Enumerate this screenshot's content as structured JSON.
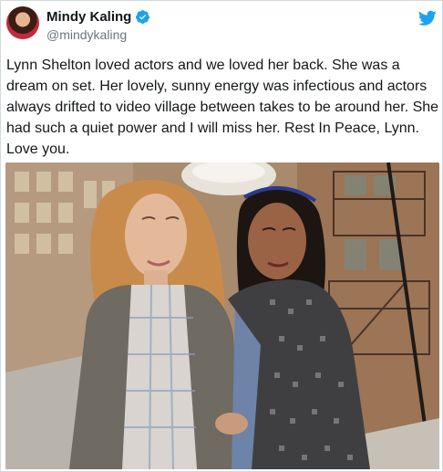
{
  "author": {
    "display_name": "Mindy Kaling",
    "handle": "@mindykaling",
    "verified": true,
    "avatar_icon": "profile-avatar"
  },
  "brand": {
    "icon": "twitter-bird-icon",
    "color": "#1da1f2"
  },
  "tweet": {
    "lines": [
      "Lynn Shelton loved actors and we loved her back. She was a",
      "dream on set. Her lovely, sunny energy was infectious and actors",
      "always drifted to video village between takes to be around her. She",
      "had such a quiet power and I will miss her. Rest In Peace, Lynn.",
      "Love you."
    ]
  },
  "media": {
    "type": "photo",
    "description_icon": "photo-two-women-icon"
  },
  "colors": {
    "text": "#14171a",
    "secondary": "#657786",
    "border": "#cfd9de",
    "verified": "#1da1f2"
  }
}
